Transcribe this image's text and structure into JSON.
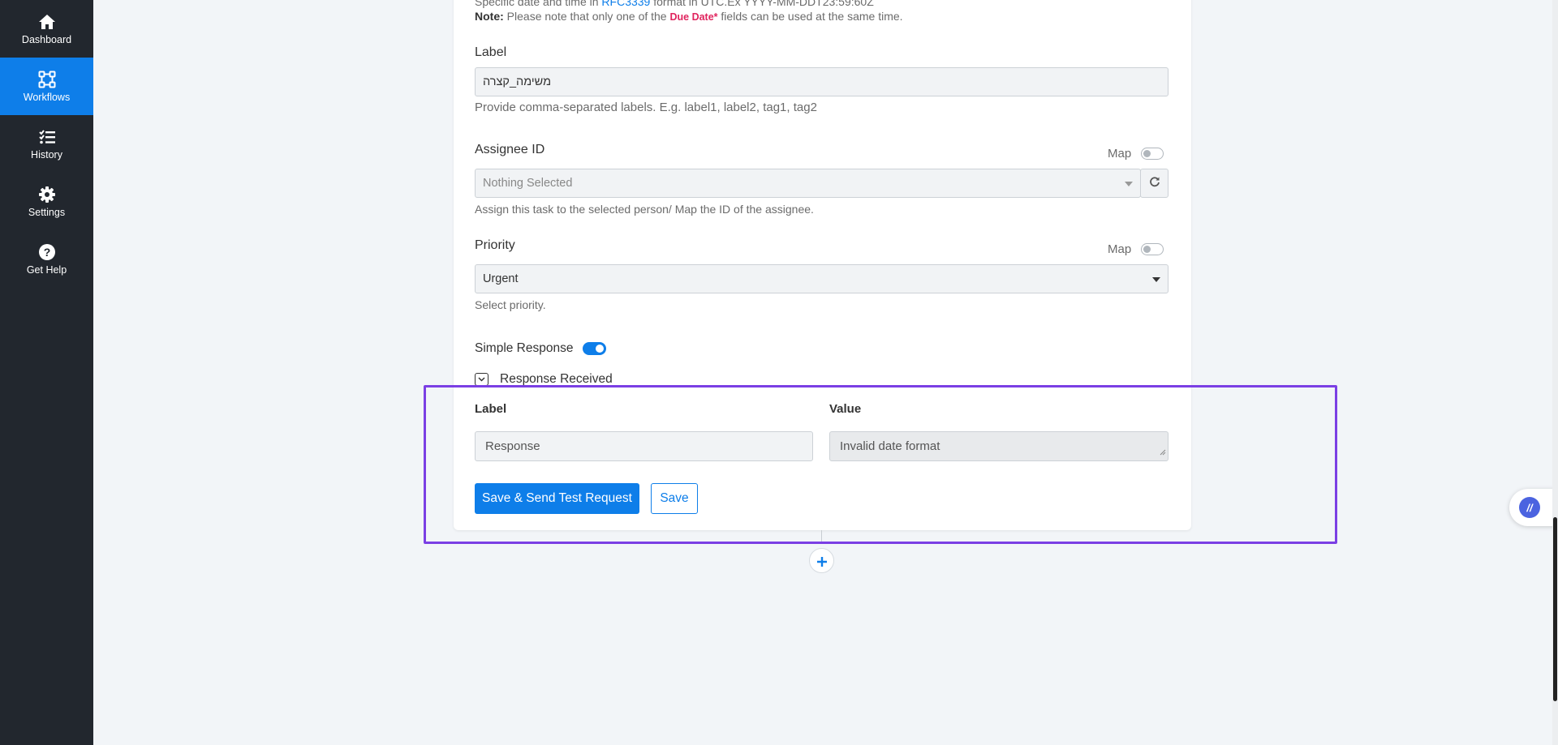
{
  "sidebar": {
    "items": [
      {
        "label": "Dashboard",
        "icon": "home-icon"
      },
      {
        "label": "Workflows",
        "icon": "workflow-icon"
      },
      {
        "label": "History",
        "icon": "history-list-icon"
      },
      {
        "label": "Settings",
        "icon": "gear-icon"
      },
      {
        "label": "Get Help",
        "icon": "help-circle-icon"
      }
    ],
    "active_index": 1
  },
  "due_date": {
    "help_prefix": "Specific date and time in ",
    "help_link": "RFC3339",
    "help_suffix": " format in UTC.Ex YYYY-MM-DDT23:59:60Z",
    "note_bold": "Note:",
    "note_text": " Please note that only one of the ",
    "note_highlight": "Due Date*",
    "note_end": " fields can be used at the same time."
  },
  "label_field": {
    "label": "Label",
    "value": "משימה_קצרה",
    "help": "Provide comma-separated labels. E.g. label1, label2, tag1, tag2"
  },
  "assignee": {
    "label": "Assignee ID",
    "map_label": "Map",
    "placeholder": "Nothing Selected",
    "help": "Assign this task to the selected person/ Map the ID of the assignee."
  },
  "priority": {
    "label": "Priority",
    "map_label": "Map",
    "value": "Urgent",
    "help": "Select priority."
  },
  "simple_response": {
    "label": "Simple Response",
    "enabled": true
  },
  "response": {
    "title": "Response Received",
    "label_header": "Label",
    "value_header": "Value",
    "label_value": "Response",
    "value_value": "Invalid date format"
  },
  "actions": {
    "save_send": "Save & Send Test Request",
    "save": "Save"
  },
  "colors": {
    "accent": "#0e7ee9",
    "sidebar_bg": "#22272e",
    "highlight": "#7b3fe4",
    "note_highlight": "#e0245e"
  }
}
